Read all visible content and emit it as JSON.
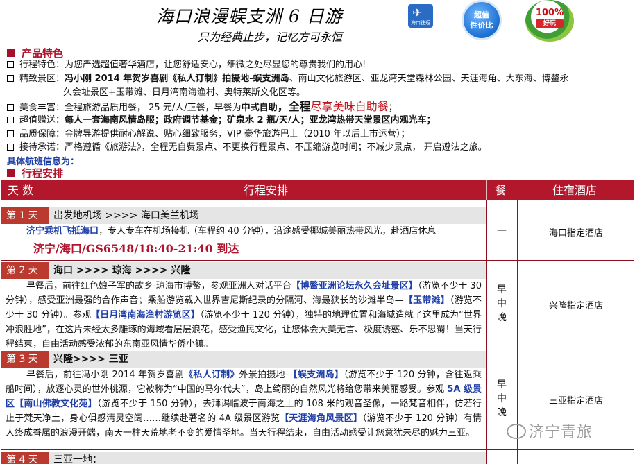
{
  "header": {
    "title": "海口浪漫蜈支洲 6 日游",
    "subtitle": "只为经典止步，记忆方可永恒",
    "logo_text": "海口往返",
    "badge_value_1": "超值",
    "badge_value_2": "性价比",
    "badge_fun_pct": "100%",
    "badge_fun_label": "好玩"
  },
  "features": {
    "section_title": "产品特色",
    "items": [
      {
        "label": "行程特色：",
        "text": "为您严选超值奢华酒店，让您舒适安心，细微之处尽显您的尊贵我们的用心!"
      },
      {
        "label": "精致景区：",
        "lead": "冯小刚 2014 年贺岁喜剧《私人订制》拍摄地-蜈支洲岛",
        "text": "、南山文化旅游区、亚龙湾天堂森林公园、天涯海角、大东海、博鳌永",
        "text2": "久会址景区+玉带滩、日月湾南海渔村、奥特莱斯文化区等。"
      },
      {
        "label": "美食丰富：",
        "text": "全程旅游品质用餐， 25 元/人/正餐，早餐为",
        "bold": "中式自助",
        "bold2": "，全程",
        "red": "尽享美味自助餐",
        "end": "；"
      },
      {
        "label": "超值赠送：",
        "text": "每人一套海南风情岛服；政府调节基金；矿泉水 2 瓶/天/人；亚龙湾热带天堂景区内观光车；"
      },
      {
        "label": "品质保障：",
        "text": "金牌导游提供耐心解说、贴心细致服务，VIP 豪华旅游巴士（2010 年以后上市运营）；"
      },
      {
        "label": "接待承诺：",
        "text": "严格遵循《旅游法》，全程无自费景点、不更换行程景点、不压缩游览时间；不减少景点， 开启遵法之旅。"
      }
    ],
    "flight_info": "具体航班信息为："
  },
  "itinerary": {
    "section_title": "行程安排",
    "headers": {
      "day": "天 数",
      "plan": "行程安排",
      "meal": "餐",
      "hotel": "住宿酒店"
    },
    "days": [
      {
        "tag": "第 1 天",
        "route": "出发地机场 >>>> 海口美兰机场",
        "hl": "济宁乘机飞抵海口",
        "text": "，专人专车在机场接机（车程约 40 分钟），沿途感受椰城美丽热带风光，赴酒店休息。",
        "flight": "济宁/海口/GS6548/18:40-21:40 到达",
        "meal": "—",
        "hotel": "海口指定酒店"
      },
      {
        "tag": "第 2 天",
        "route": "海口 >>>> 琼海 >>>> 兴隆",
        "p1": "早餐后，前往红色娘子军的故乡-琼海市博鳌，参观亚洲人对话平台",
        "h1": "【博鳌亚洲论坛永久会址景区】",
        "p2": "（游览不少于 30 分钟），感受亚洲最强的合作声音；乘船游览载入世界吉尼斯纪录的分隔河、海最狭长的沙滩半岛—",
        "h2": "【玉带滩】",
        "p3": "（游览不少于 30 分钟）。参观",
        "h3": "【日月湾南海渔村游览区】",
        "p4": "（游览不少于 120 分钟），独特的地理位置和海域造就了这里成为“世界冲浪胜地”，在这片未经太多雕琢的海域看层层浪花，感受渔民文化，让您体会大美无言、极度诱惑、乐不思蜀！当天行程结束，自由活动感受浓郁的东南亚风情华侨小镇。",
        "meal": [
          "早",
          "中",
          "晚"
        ],
        "hotel": "兴隆指定酒店"
      },
      {
        "tag": "第 3 天",
        "route": "兴隆>>>> 三亚",
        "p1": "早餐后，前往冯小刚 2014 年贺岁喜剧",
        "h1": "《私人订制》",
        "p2": "外景拍摄地-",
        "h2": "【蜈支洲岛】",
        "p3": "（游览不少于 120 分钟，含往返乘船时间），放逐心灵的世外桃源，它被称为“中国的马尔代夫”，岛上绮丽的自然风光将给您带来美丽感受。参观 ",
        "h3": "5A 级景区【南山佛教文化苑】",
        "p4": "（游览不少于 150 分钟），去拜谒临波于南海之上的 108 米的观音圣像，一路梵音相伴，仿若行止于梵天净土，身心俱感清灵空阔……继续赴著名的 4A 级景区游览",
        "h4": "【天涯海角风景区】",
        "p5": "（游览不少于 120 分钟）有情人终成眷属的浪漫开端，南天一柱天荒地老不变的爱情圣地。当天行程结束，自由活动感受让您意犹未尽的魅力三亚。",
        "meal": [
          "早",
          "中",
          "晚"
        ],
        "hotel": "三亚指定酒店"
      },
      {
        "tag": "第 4 天",
        "route": "三亚一地："
      }
    ]
  },
  "watermark": "济宁青旅",
  "colors": {
    "accent": "#b3172b",
    "day_tag": "#ba3a30",
    "highlight": "#1f3fa8"
  }
}
